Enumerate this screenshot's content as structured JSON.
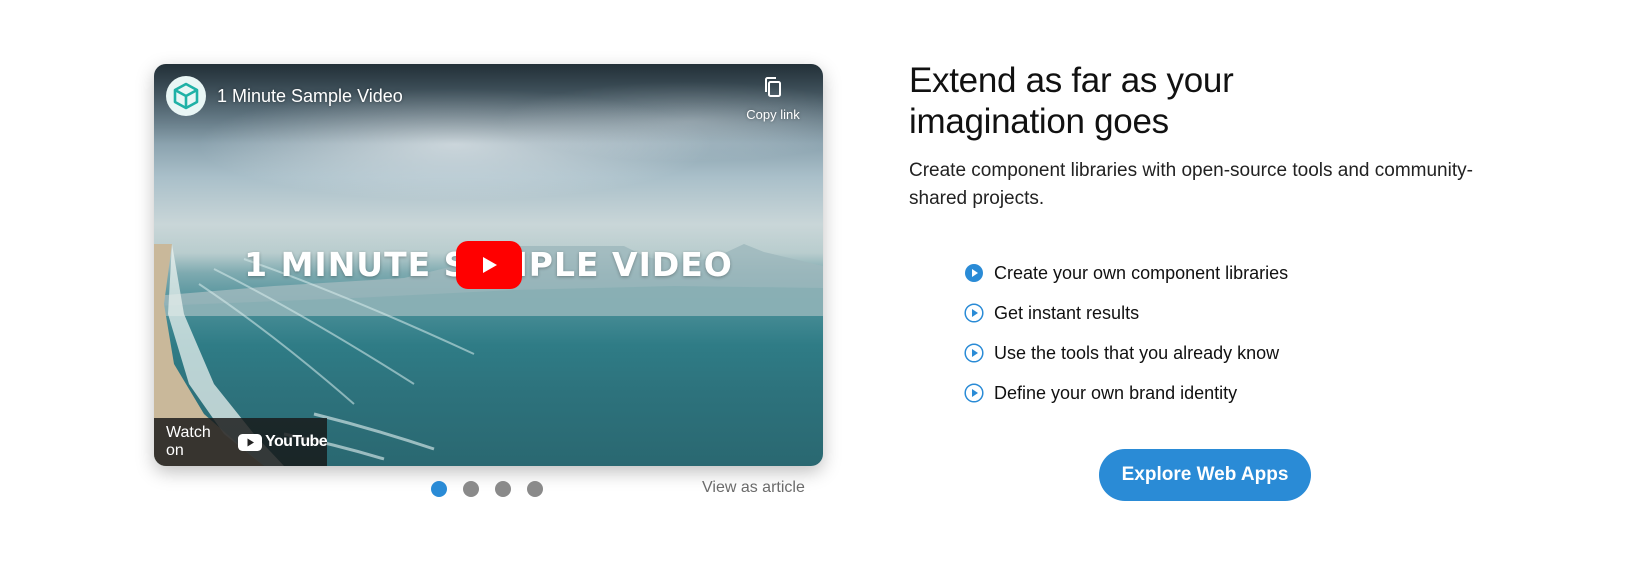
{
  "video": {
    "title": "1 Minute Sample Video",
    "copy_link_label": "Copy link",
    "overlay_caption": "1 MINUTE SAMPLE VIDEO",
    "watch_on_label": "Watch on",
    "youtube_wordmark": "YouTube",
    "channel_logo_icon": "cube-logo-icon",
    "play_icon": "youtube-play-icon"
  },
  "carousel": {
    "slides": 4,
    "active_index": 0,
    "view_as_article": "View as article",
    "active_color": "#2a8bd6",
    "inactive_color": "#8a8a8a"
  },
  "content": {
    "heading_line1": "Extend as far as your",
    "heading_line2": "imagination goes",
    "subtext": "Create component libraries with open-source tools and community-shared projects.",
    "features": [
      {
        "label": "Create your own component libraries",
        "icon": "play-circle-filled-icon"
      },
      {
        "label": "Get instant results",
        "icon": "play-circle-outline-icon"
      },
      {
        "label": "Use the tools that you already know",
        "icon": "play-circle-outline-icon"
      },
      {
        "label": "Define your own brand identity",
        "icon": "play-circle-outline-icon"
      }
    ],
    "cta_label": "Explore Web Apps"
  },
  "colors": {
    "accent": "#2a8bd6",
    "youtube_red": "#ff0000"
  }
}
